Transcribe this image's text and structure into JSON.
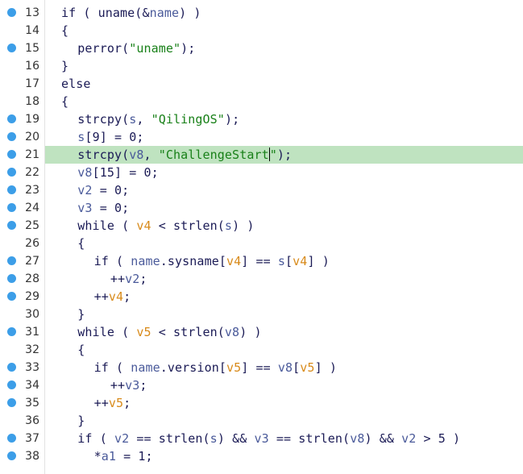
{
  "colors": {
    "breakpoint": "#3c9ee8",
    "highlight": "#bfe3c0",
    "string": "#188018",
    "global_var": "#4a5a9a",
    "local_var": "#d88a1a",
    "text": "#1a1a55"
  },
  "editor": {
    "highlighted_line": 21,
    "cursor_line": 21,
    "lines": [
      {
        "num": "13",
        "bp": true,
        "indent": 0,
        "tokens": [
          {
            "t": "if ( uname(&",
            "c": "p"
          },
          {
            "t": "name",
            "c": "g"
          },
          {
            "t": ") )",
            "c": "p"
          }
        ]
      },
      {
        "num": "14",
        "bp": false,
        "indent": 0,
        "tokens": [
          {
            "t": "{",
            "c": "p"
          }
        ]
      },
      {
        "num": "15",
        "bp": true,
        "indent": 1,
        "tokens": [
          {
            "t": "perror(",
            "c": "p"
          },
          {
            "t": "\"uname\"",
            "c": "str"
          },
          {
            "t": ");",
            "c": "p"
          }
        ]
      },
      {
        "num": "16",
        "bp": false,
        "indent": 0,
        "tokens": [
          {
            "t": "}",
            "c": "p"
          }
        ]
      },
      {
        "num": "17",
        "bp": false,
        "indent": 0,
        "tokens": [
          {
            "t": "else",
            "c": "p"
          }
        ]
      },
      {
        "num": "18",
        "bp": false,
        "indent": 0,
        "tokens": [
          {
            "t": "{",
            "c": "p"
          }
        ]
      },
      {
        "num": "19",
        "bp": true,
        "indent": 1,
        "tokens": [
          {
            "t": "strcpy(",
            "c": "p"
          },
          {
            "t": "s",
            "c": "g"
          },
          {
            "t": ", ",
            "c": "p"
          },
          {
            "t": "\"QilingOS\"",
            "c": "str"
          },
          {
            "t": ");",
            "c": "p"
          }
        ]
      },
      {
        "num": "20",
        "bp": true,
        "indent": 1,
        "tokens": [
          {
            "t": "s",
            "c": "g"
          },
          {
            "t": "[9] = 0;",
            "c": "p"
          }
        ]
      },
      {
        "num": "21",
        "bp": true,
        "indent": 1,
        "highlight": true,
        "tokens": [
          {
            "t": "strcpy(",
            "c": "p"
          },
          {
            "t": "v8",
            "c": "g"
          },
          {
            "t": ", ",
            "c": "p"
          },
          {
            "t": "\"ChallengeStart",
            "c": "str"
          },
          {
            "t": "",
            "c": "cursor"
          },
          {
            "t": "\"",
            "c": "str"
          },
          {
            "t": ");",
            "c": "p"
          }
        ]
      },
      {
        "num": "22",
        "bp": true,
        "indent": 1,
        "tokens": [
          {
            "t": "v8",
            "c": "g"
          },
          {
            "t": "[15] = 0;",
            "c": "p"
          }
        ]
      },
      {
        "num": "23",
        "bp": true,
        "indent": 1,
        "tokens": [
          {
            "t": "v2",
            "c": "g"
          },
          {
            "t": " = 0;",
            "c": "p"
          }
        ]
      },
      {
        "num": "24",
        "bp": true,
        "indent": 1,
        "tokens": [
          {
            "t": "v3",
            "c": "g"
          },
          {
            "t": " = 0;",
            "c": "p"
          }
        ]
      },
      {
        "num": "25",
        "bp": true,
        "indent": 1,
        "tokens": [
          {
            "t": "while ( ",
            "c": "p"
          },
          {
            "t": "v4",
            "c": "l"
          },
          {
            "t": " < strlen(",
            "c": "p"
          },
          {
            "t": "s",
            "c": "g"
          },
          {
            "t": ") )",
            "c": "p"
          }
        ]
      },
      {
        "num": "26",
        "bp": false,
        "indent": 1,
        "tokens": [
          {
            "t": "{",
            "c": "p"
          }
        ]
      },
      {
        "num": "27",
        "bp": true,
        "indent": 2,
        "tokens": [
          {
            "t": "if ( ",
            "c": "p"
          },
          {
            "t": "name",
            "c": "g"
          },
          {
            "t": ".sysname[",
            "c": "p"
          },
          {
            "t": "v4",
            "c": "l"
          },
          {
            "t": "] == ",
            "c": "p"
          },
          {
            "t": "s",
            "c": "g"
          },
          {
            "t": "[",
            "c": "p"
          },
          {
            "t": "v4",
            "c": "l"
          },
          {
            "t": "] )",
            "c": "p"
          }
        ]
      },
      {
        "num": "28",
        "bp": true,
        "indent": 3,
        "tokens": [
          {
            "t": "++",
            "c": "p"
          },
          {
            "t": "v2",
            "c": "g"
          },
          {
            "t": ";",
            "c": "p"
          }
        ]
      },
      {
        "num": "29",
        "bp": true,
        "indent": 2,
        "tokens": [
          {
            "t": "++",
            "c": "p"
          },
          {
            "t": "v4",
            "c": "l"
          },
          {
            "t": ";",
            "c": "p"
          }
        ]
      },
      {
        "num": "30",
        "bp": false,
        "indent": 1,
        "tokens": [
          {
            "t": "}",
            "c": "p"
          }
        ]
      },
      {
        "num": "31",
        "bp": true,
        "indent": 1,
        "tokens": [
          {
            "t": "while ( ",
            "c": "p"
          },
          {
            "t": "v5",
            "c": "l"
          },
          {
            "t": " < strlen(",
            "c": "p"
          },
          {
            "t": "v8",
            "c": "g"
          },
          {
            "t": ") )",
            "c": "p"
          }
        ]
      },
      {
        "num": "32",
        "bp": false,
        "indent": 1,
        "tokens": [
          {
            "t": "{",
            "c": "p"
          }
        ]
      },
      {
        "num": "33",
        "bp": true,
        "indent": 2,
        "tokens": [
          {
            "t": "if ( ",
            "c": "p"
          },
          {
            "t": "name",
            "c": "g"
          },
          {
            "t": ".version[",
            "c": "p"
          },
          {
            "t": "v5",
            "c": "l"
          },
          {
            "t": "] == ",
            "c": "p"
          },
          {
            "t": "v8",
            "c": "g"
          },
          {
            "t": "[",
            "c": "p"
          },
          {
            "t": "v5",
            "c": "l"
          },
          {
            "t": "] )",
            "c": "p"
          }
        ]
      },
      {
        "num": "34",
        "bp": true,
        "indent": 3,
        "tokens": [
          {
            "t": "++",
            "c": "p"
          },
          {
            "t": "v3",
            "c": "g"
          },
          {
            "t": ";",
            "c": "p"
          }
        ]
      },
      {
        "num": "35",
        "bp": true,
        "indent": 2,
        "tokens": [
          {
            "t": "++",
            "c": "p"
          },
          {
            "t": "v5",
            "c": "l"
          },
          {
            "t": ";",
            "c": "p"
          }
        ]
      },
      {
        "num": "36",
        "bp": false,
        "indent": 1,
        "tokens": [
          {
            "t": "}",
            "c": "p"
          }
        ]
      },
      {
        "num": "37",
        "bp": true,
        "indent": 1,
        "tokens": [
          {
            "t": "if ( ",
            "c": "p"
          },
          {
            "t": "v2",
            "c": "g"
          },
          {
            "t": " == strlen(",
            "c": "p"
          },
          {
            "t": "s",
            "c": "g"
          },
          {
            "t": ") && ",
            "c": "p"
          },
          {
            "t": "v3",
            "c": "g"
          },
          {
            "t": " == strlen(",
            "c": "p"
          },
          {
            "t": "v8",
            "c": "g"
          },
          {
            "t": ") && ",
            "c": "p"
          },
          {
            "t": "v2",
            "c": "g"
          },
          {
            "t": " > 5 )",
            "c": "p"
          }
        ]
      },
      {
        "num": "38",
        "bp": true,
        "indent": 2,
        "tokens": [
          {
            "t": "*",
            "c": "p"
          },
          {
            "t": "a1",
            "c": "g"
          },
          {
            "t": " = 1;",
            "c": "p"
          }
        ]
      }
    ]
  }
}
